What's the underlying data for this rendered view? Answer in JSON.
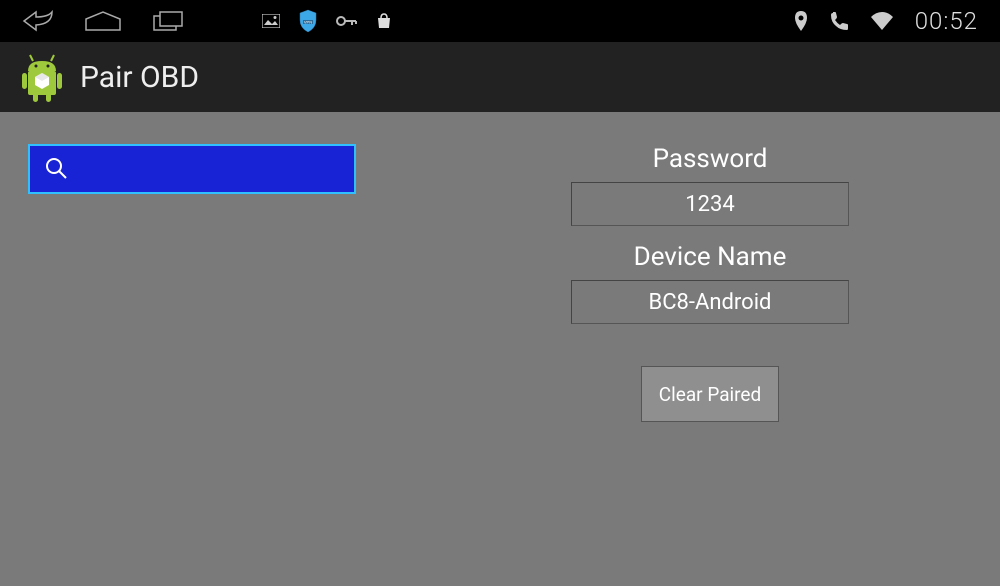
{
  "status_bar": {
    "clock": "00:52"
  },
  "app_header": {
    "title": "Pair OBD"
  },
  "search": {
    "value": ""
  },
  "form": {
    "password_label": "Password",
    "password_value": "1234",
    "device_name_label": "Device Name",
    "device_name_value": "BC8-Android",
    "clear_paired_label": "Clear Paired"
  }
}
